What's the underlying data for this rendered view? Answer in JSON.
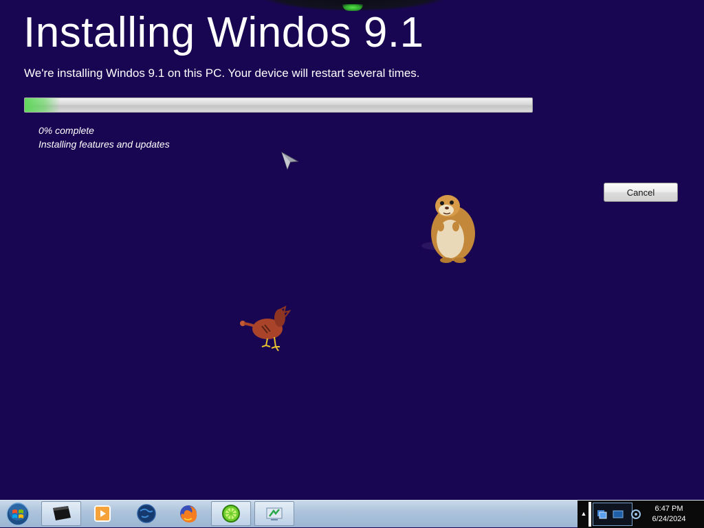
{
  "installer": {
    "title": "Installing Windos 9.1",
    "subtitle": "We're installing Windos 9.1 on this PC. Your device will restart several times.",
    "progress_fraction": 0.0,
    "status_percent": "0% complete",
    "status_task": "Installing features and updates",
    "cancel_label": "Cancel"
  },
  "desktop_buddies": [
    "hamster-sprite",
    "bird-sprite"
  ],
  "taskbar": {
    "start_icon": "windows-orb-icon",
    "pinned": [
      {
        "icon": "terminal-window-icon",
        "active": true
      },
      {
        "icon": "media-player-icon",
        "active": false
      },
      {
        "icon": "globe-icon",
        "active": false
      },
      {
        "icon": "firefox-icon",
        "active": false
      },
      {
        "icon": "lime-app-icon",
        "active": true
      },
      {
        "icon": "display-settings-icon",
        "active": true
      }
    ],
    "tray_icons": [
      "show-hidden-arrow-icon",
      "network-icon",
      "monitor-icon",
      "volume-icon"
    ],
    "clock_time": "6:47 PM",
    "clock_date": "6/24/2024"
  },
  "colors": {
    "background": "#190652",
    "progress_fill": "#4fcf4a",
    "text": "#ffffff"
  }
}
